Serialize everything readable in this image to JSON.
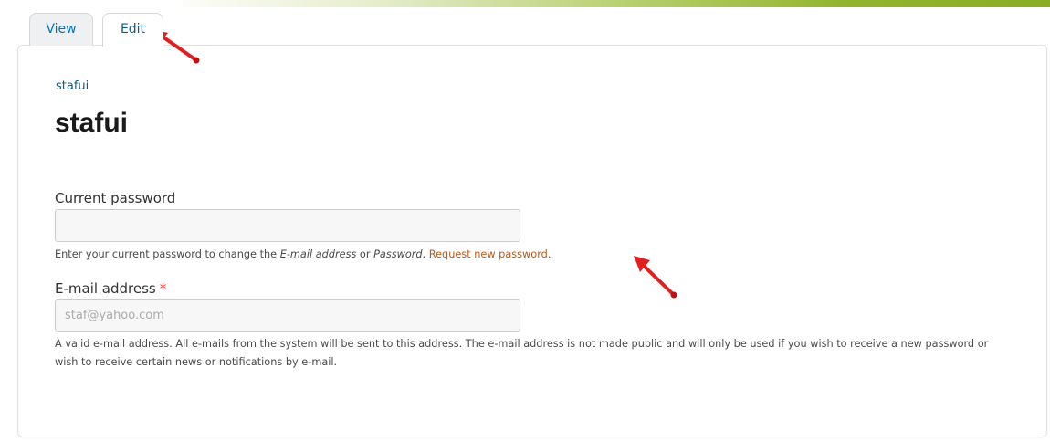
{
  "tabs": [
    {
      "label": "View"
    },
    {
      "label": "Edit"
    }
  ],
  "breadcrumb": {
    "label": "stafui"
  },
  "page": {
    "title": "stafui"
  },
  "form": {
    "current_password": {
      "label": "Current password",
      "value": "",
      "help_prefix": "Enter your current password to change the ",
      "help_email_term": "E-mail address",
      "help_or": " or ",
      "help_password_term": "Password",
      "help_dot": ". ",
      "request_link": "Request new password",
      "help_end": "."
    },
    "email": {
      "label": "E-mail address",
      "required_marker": "*",
      "placeholder": "staf@yahoo.com",
      "help": "A valid e-mail address. All e-mails from the system will be sent to this address. The e-mail address is not made public and will only be used if you wish to receive a new password or wish to receive certain news or notifications by e-mail."
    }
  },
  "colors": {
    "link": "#0c5c88",
    "request_link": "#b8581a",
    "required": "#e0393e",
    "annotation_arrow": "#e02020",
    "top_bar_accent": "#8aad24"
  }
}
